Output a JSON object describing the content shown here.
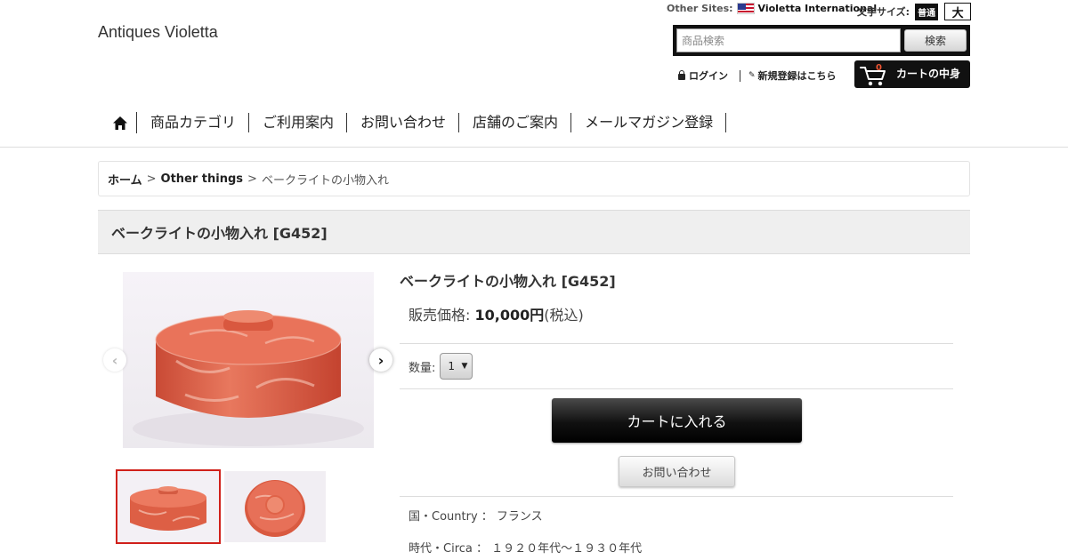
{
  "site": {
    "title": "Antiques Violetta"
  },
  "header": {
    "other_sites_label": "Other Sites:",
    "international_label": "Violetta International",
    "font_size_label": "文字サイズ:",
    "font_normal": "普通",
    "font_large": "大",
    "search_placeholder": "商品検索",
    "search_button": "検索",
    "login": "ログイン",
    "register": "新規登録はこちら",
    "cart_label": "カートの中身",
    "cart_count": "0"
  },
  "nav": {
    "items": [
      "商品カテゴリ",
      "ご利用案内",
      "お問い合わせ",
      "店舗のご案内",
      "メールマガジン登録"
    ]
  },
  "breadcrumb": {
    "home": "ホーム",
    "sep": ">",
    "category": "Other things",
    "current": "ベークライトの小物入れ"
  },
  "product": {
    "title_bar": "ベークライトの小物入れ [G452]",
    "name": "ベークライトの小物入れ [G452]",
    "price_label": "販売価格:",
    "price": "10,000円",
    "tax_note": "(税込)",
    "qty_label": "数量:",
    "qty_value": "1",
    "add_to_cart": "カートに入れる",
    "inquiry": "お問い合わせ",
    "country": "国・Country ： フランス",
    "circa": "時代・Circa ： １９２０年代〜１９３０年代"
  },
  "colors": {
    "accent": "#d0201a",
    "cart_bg": "#111111",
    "product_orange": "#e2634a"
  }
}
